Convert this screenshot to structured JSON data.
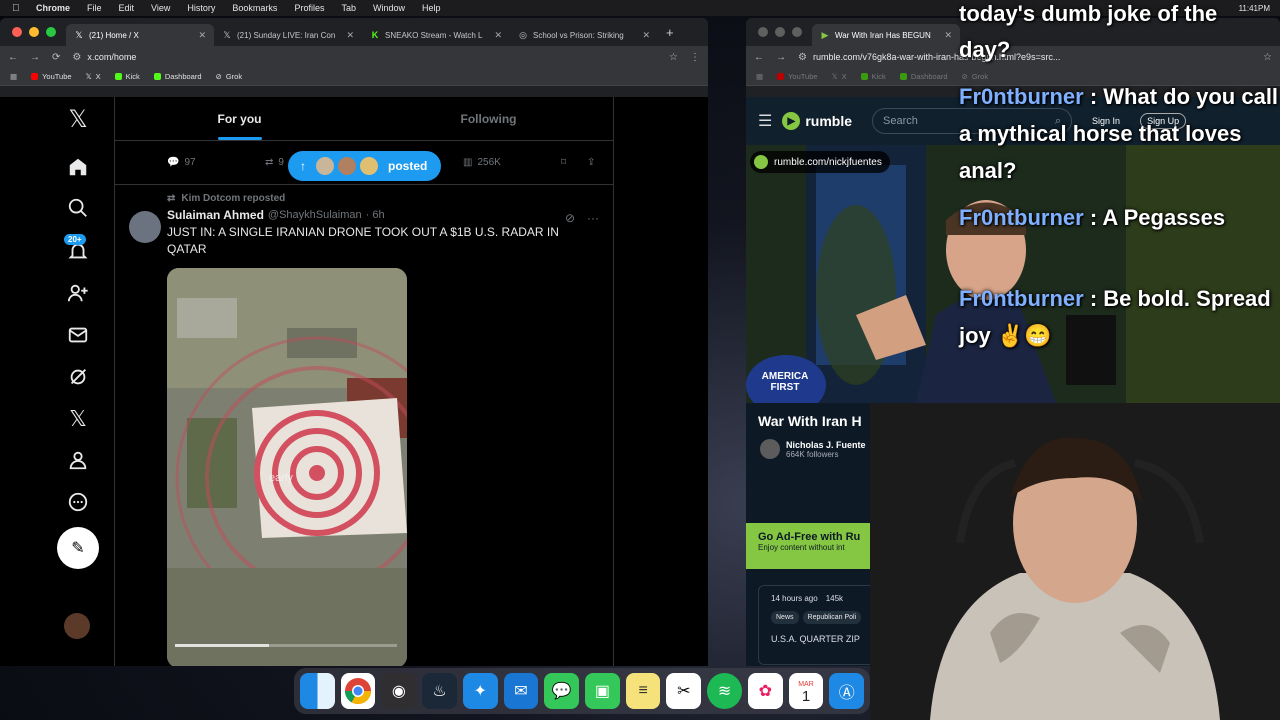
{
  "menubar": {
    "app": "Chrome",
    "items": [
      "File",
      "Edit",
      "View",
      "History",
      "Bookmarks",
      "Profiles",
      "Tab",
      "Window",
      "Help"
    ],
    "clock": "11:41PM"
  },
  "left_window": {
    "tabs": [
      {
        "title": "(21) Home / X",
        "active": true
      },
      {
        "title": "(21) Sunday LIVE: Iran Con",
        "active": false
      },
      {
        "title": "SNEAKO Stream - Watch L",
        "active": false
      },
      {
        "title": "School vs Prison: Striking",
        "active": false
      }
    ],
    "url": "x.com/home",
    "bookmarks": [
      {
        "label": "YouTube",
        "color": "#ff0000"
      },
      {
        "label": "X",
        "color": "#ffffff"
      },
      {
        "label": "Kick",
        "color": "#53fc18"
      },
      {
        "label": "Dashboard",
        "color": "#53fc18"
      },
      {
        "label": "Grok",
        "color": "#ffffff"
      }
    ]
  },
  "x": {
    "notification_badge": "20+",
    "feed_tabs": [
      "For you",
      "Following"
    ],
    "action_counts": {
      "replies": "97",
      "reposts": "9",
      "views": "256K"
    },
    "new_posts_pill": "posted",
    "tweet": {
      "reposted_by": "Kim Dotcom reposted",
      "name": "Sulaiman Ahmed",
      "handle": "@ShaykhSulaiman",
      "time": "· 6h",
      "text": "JUST IN: A SINGLE IRANIAN DRONE TOOK OUT A $1B U.S. RADAR IN QATAR",
      "media_caption": "early"
    }
  },
  "right_window": {
    "tab_title": "War With Iran Has BEGUN",
    "url": "rumble.com/v76gk8a-war-with-iran-has-begun.html?e9s=src...",
    "bookmarks": [
      "YouTube",
      "X",
      "Kick",
      "Dashboard",
      "Grok"
    ]
  },
  "rumble": {
    "logo": "rumble",
    "search_placeholder": "Search",
    "sign_in": "Sign In",
    "sign_up": "Sign Up",
    "channel_link": "rumble.com/nickjfuentes",
    "hat_text": "AMERICA FIRST",
    "video_title": "War With Iran H",
    "channel_name": "Nicholas J. Fuente",
    "followers": "664K followers",
    "promo_title": "Go Ad-Free with Ru",
    "promo_sub": "Enjoy content without int",
    "meta_time": "14 hours ago",
    "meta_views": "145k",
    "tags": [
      "News",
      "Republican Poli"
    ],
    "description": "U.S.A. QUARTER ZIP"
  },
  "chat": {
    "header": "today's dumb joke of the day?",
    "messages": [
      {
        "user": "Fr0ntburner",
        "text": ": What do you call a mythical horse that loves anal?"
      },
      {
        "user": "Fr0ntburner",
        "text": ": A Pegasses"
      },
      {
        "user": "Fr0ntburner",
        "text": ": Be bold. Spread joy ✌️😁"
      }
    ]
  },
  "dock": {
    "apps": [
      "finder",
      "chrome",
      "obs",
      "steam",
      "safari",
      "mail",
      "messages",
      "facetime",
      "notes",
      "capcut",
      "spotify",
      "photos",
      "calendar",
      "app-store"
    ],
    "calendar_month": "MAR",
    "calendar_day": "1"
  }
}
